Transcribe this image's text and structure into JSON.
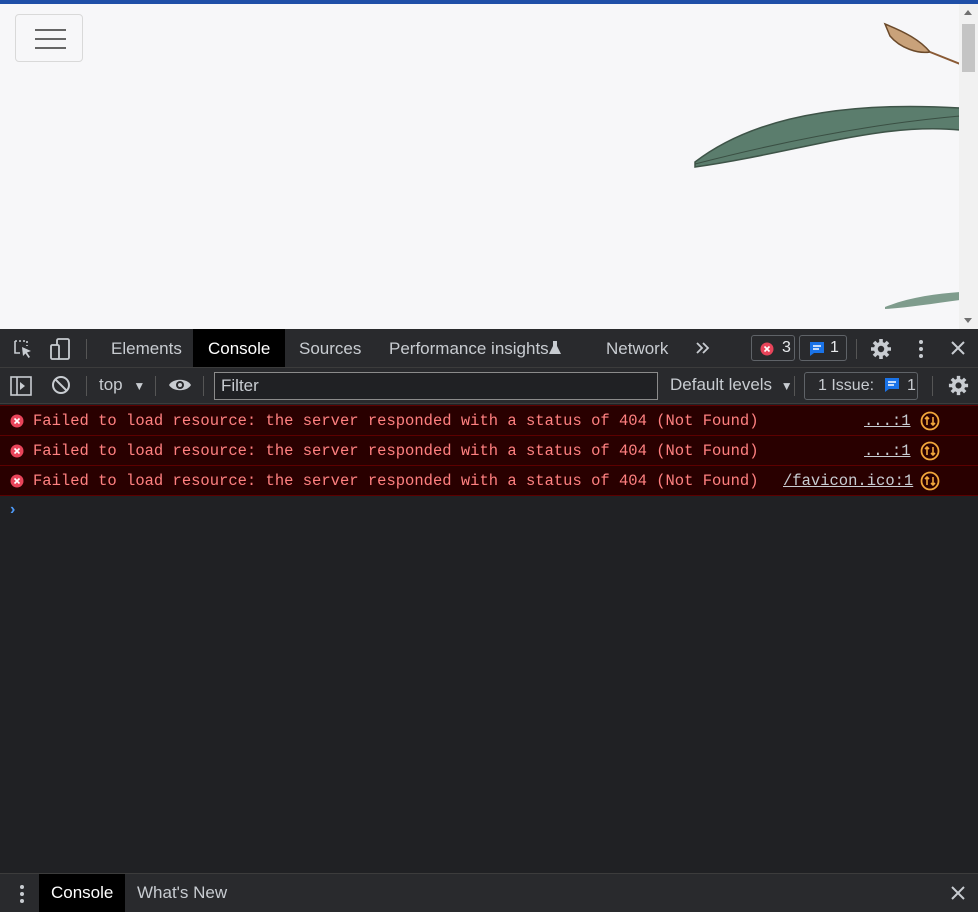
{
  "devtools": {
    "tabs": [
      "Elements",
      "Console",
      "Sources",
      "Performance insights",
      "Network"
    ],
    "active_tab": "Console",
    "error_count": "3",
    "message_count": "1"
  },
  "toolbar": {
    "context": "top",
    "filter_placeholder": "Filter",
    "levels": "Default levels",
    "issues_label": "1 Issue:",
    "issues_count": "1"
  },
  "console": {
    "messages": [
      {
        "text": "Failed to load resource: the server responded with a status of 404 (Not Found)",
        "source": "...:1"
      },
      {
        "text": "Failed to load resource: the server responded with a status of 404 (Not Found)",
        "source": "...:1"
      },
      {
        "text": "Failed to load resource: the server responded with a status of 404 (Not Found)",
        "source": "/favicon.ico:1"
      }
    ]
  },
  "drawer": {
    "tabs": [
      "Console",
      "What's New"
    ]
  },
  "colors": {
    "error_bg": "#290000",
    "error_text": "#ff8080",
    "accent": "#1a73e8"
  }
}
